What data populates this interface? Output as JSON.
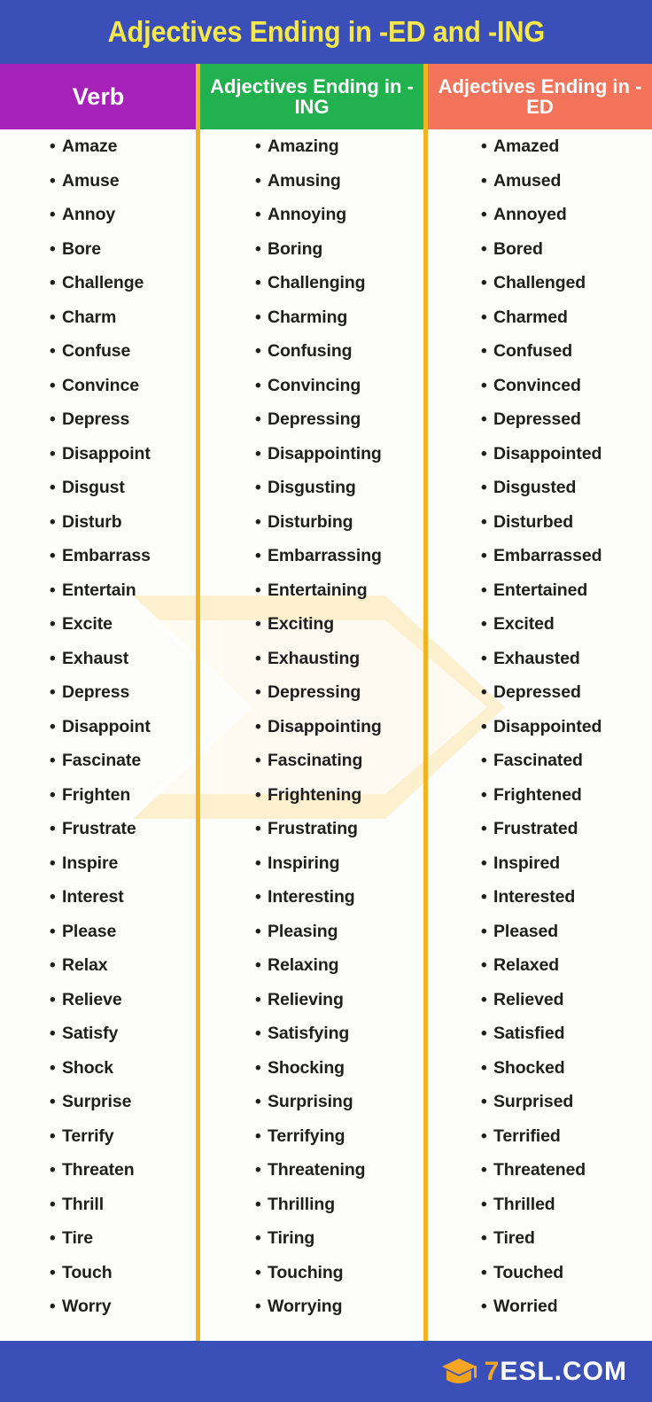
{
  "title": "Adjectives Ending in -ED and -ING",
  "colors": {
    "banner_blue": "#3a4fb8",
    "title_yellow": "#f7e84a",
    "verb_purple": "#a621b8",
    "ing_green": "#21b14e",
    "ed_orange": "#f4745b",
    "divider_gold": "#f0b323",
    "watermark_cream": "#fcf2d8",
    "text_dark": "#1e1e1e",
    "logo_gold": "#f5a623"
  },
  "headers": {
    "verb": "Verb",
    "ing": "Adjectives Ending in -ING",
    "ed": "Adjectives Ending in -ED"
  },
  "columns": {
    "verb": [
      "Amaze",
      "Amuse",
      "Annoy",
      "Bore",
      "Challenge",
      "Charm",
      "Confuse",
      "Convince",
      "Depress",
      "Disappoint",
      "Disgust",
      "Disturb",
      "Embarrass",
      "Entertain",
      "Excite",
      "Exhaust",
      "Depress",
      "Disappoint",
      "Fascinate",
      "Frighten",
      "Frustrate",
      "Inspire",
      "Interest",
      "Please",
      "Relax",
      "Relieve",
      "Satisfy",
      "Shock",
      "Surprise",
      "Terrify",
      "Threaten",
      "Thrill",
      "Tire",
      "Touch",
      "Worry"
    ],
    "ing": [
      "Amazing",
      "Amusing",
      "Annoying",
      "Boring",
      "Challenging",
      "Charming",
      "Confusing",
      "Convincing",
      "Depressing",
      "Disappointing",
      "Disgusting",
      "Disturbing",
      "Embarrassing",
      "Entertaining",
      "Exciting",
      "Exhausting",
      "Depressing",
      "Disappointing",
      "Fascinating",
      "Frightening",
      "Frustrating",
      "Inspiring",
      "Interesting",
      "Pleasing",
      "Relaxing",
      "Relieving",
      "Satisfying",
      "Shocking",
      "Surprising",
      "Terrifying",
      "Threatening",
      "Thrilling",
      "Tiring",
      "Touching",
      "Worrying"
    ],
    "ed": [
      "Amazed",
      "Amused",
      "Annoyed",
      "Bored",
      "Challenged",
      "Charmed",
      "Confused",
      "Convinced",
      "Depressed",
      "Disappointed",
      "Disgusted",
      "Disturbed",
      "Embarrassed",
      "Entertained",
      "Excited",
      "Exhausted",
      "Depressed",
      "Disappointed",
      "Fascinated",
      "Frightened",
      "Frustrated",
      "Inspired",
      "Interested",
      "Pleased",
      "Relaxed",
      "Relieved",
      "Satisfied",
      "Shocked",
      "Surprised",
      "Terrified",
      "Threatened",
      "Thrilled",
      "Tired",
      "Touched",
      "Worried"
    ]
  },
  "footer": {
    "logo_seven": "7",
    "logo_rest": "ESL.COM",
    "logo_icon": "graduation-cap-icon"
  }
}
